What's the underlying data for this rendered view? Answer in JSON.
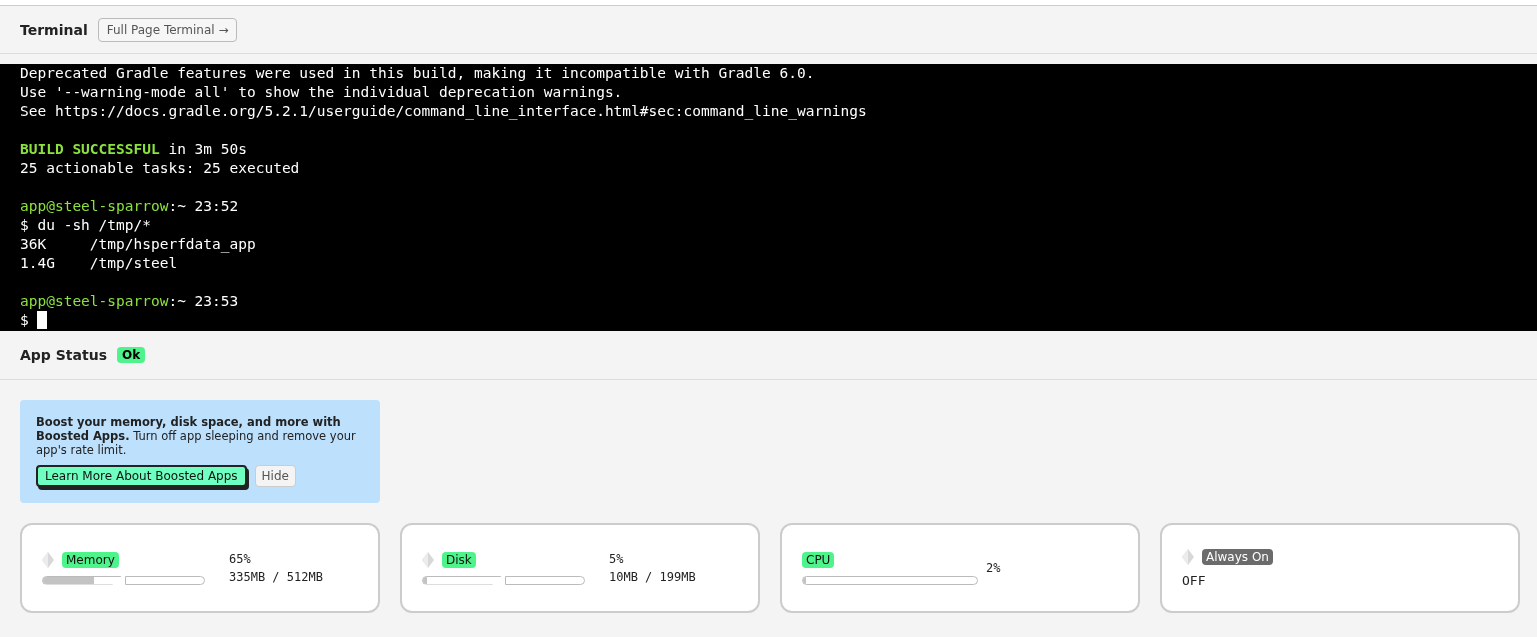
{
  "terminal": {
    "title": "Terminal",
    "full_page_button": "Full Page Terminal →",
    "blocks": [
      [
        [
          {
            "kind": "plain",
            "text": "Deprecated Gradle features were used in this build, making it incompatible with Gradle 6.0."
          }
        ],
        [
          {
            "kind": "plain",
            "text": "Use '--warning-mode all' to show the individual deprecation warnings."
          }
        ],
        [
          {
            "kind": "plain",
            "text": "See https://docs.gradle.org/5.2.1/userguide/command_line_interface.html#sec:command_line_warnings"
          }
        ]
      ],
      [
        [
          {
            "kind": "success",
            "text": "BUILD SUCCESSFUL"
          },
          {
            "kind": "plain",
            "text": " in 3m 50s"
          }
        ],
        [
          {
            "kind": "plain",
            "text": "25 actionable tasks: 25 executed"
          }
        ]
      ],
      [
        [
          {
            "kind": "prompt",
            "text": "app@steel-sparrow"
          },
          {
            "kind": "plain",
            "text": ":~ 23:52"
          }
        ],
        [
          {
            "kind": "plain",
            "text": "$ du -sh /tmp/*"
          }
        ],
        [
          {
            "kind": "plain",
            "text": "36K     /tmp/hsperfdata_app"
          }
        ],
        [
          {
            "kind": "plain",
            "text": "1.4G    /tmp/steel"
          }
        ]
      ],
      [
        [
          {
            "kind": "prompt",
            "text": "app@steel-sparrow"
          },
          {
            "kind": "plain",
            "text": ":~ 23:53"
          }
        ],
        [
          {
            "kind": "plain",
            "text": "$ "
          },
          {
            "kind": "cursor"
          }
        ]
      ]
    ]
  },
  "app_status": {
    "title": "App Status",
    "badge": "Ok"
  },
  "promo": {
    "text": "**Boost your memory, disk space, and more with Boosted Apps.** Turn off app sleeping and remove your app's rate limit.",
    "primary_button": "Learn More About Boosted Apps",
    "secondary_button": "Hide"
  },
  "stats": [
    {
      "kind": "split",
      "label": "Memory",
      "color": "#4ef38c",
      "diamond": true,
      "level": 0.65,
      "percent": "65%",
      "detail": "335MB / 512MB"
    },
    {
      "kind": "split",
      "label": "Disk",
      "color": "#4ef38c",
      "diamond": true,
      "level": 0.05,
      "percent": "5%",
      "detail": "10MB / 199MB"
    },
    {
      "kind": "single",
      "label": "CPU",
      "color": "#4ef38c",
      "diamond": false,
      "level": 0.02,
      "percent": "2%"
    },
    {
      "kind": "text",
      "label": "Always On",
      "color": "#6b6b6b",
      "diamond": true,
      "value": "OFF"
    }
  ]
}
